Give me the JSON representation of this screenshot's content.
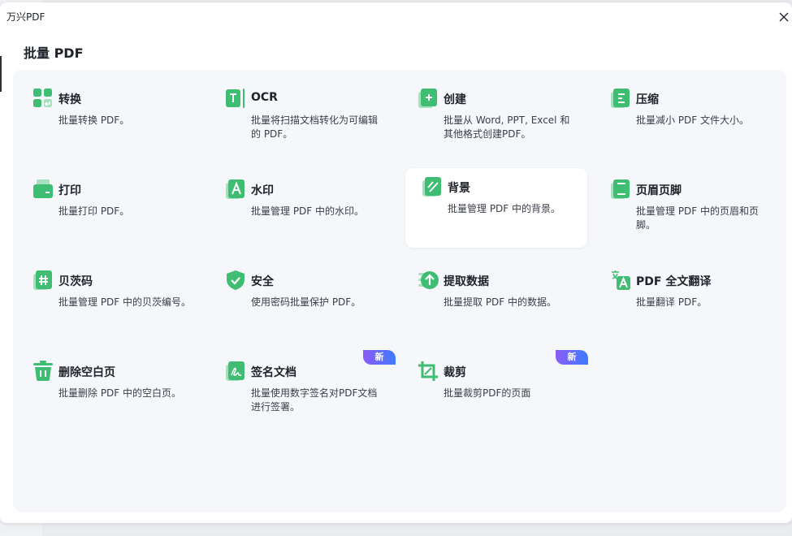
{
  "app": {
    "title": "万兴PDF"
  },
  "page": {
    "heading": "批量 PDF"
  },
  "colors": {
    "accent": "#3ebd73",
    "badge_start": "#8a5cf6",
    "badge_end": "#3e7bff"
  },
  "tools": [
    {
      "name": "转换",
      "desc": "批量转换 PDF。",
      "icon": "convert-icon"
    },
    {
      "name": "OCR",
      "desc": "批量将扫描文档转化为可编辑的 PDF。",
      "icon": "ocr-icon"
    },
    {
      "name": "创建",
      "desc": "批量从 Word, PPT, Excel 和其他格式创建PDF。",
      "icon": "create-icon"
    },
    {
      "name": "压缩",
      "desc": "批量减小 PDF 文件大小。",
      "icon": "compress-icon"
    },
    {
      "name": "打印",
      "desc": "批量打印 PDF。",
      "icon": "print-icon"
    },
    {
      "name": "水印",
      "desc": "批量管理 PDF 中的水印。",
      "icon": "watermark-icon"
    },
    {
      "name": "背景",
      "desc": "批量管理 PDF 中的背景。",
      "icon": "background-icon"
    },
    {
      "name": "页眉页脚",
      "desc": "批量管理 PDF 中的页眉和页脚。",
      "icon": "header-footer-icon"
    },
    {
      "name": "贝茨码",
      "desc": "批量管理 PDF 中的贝茨编号。",
      "icon": "bates-icon"
    },
    {
      "name": "安全",
      "desc": "使用密码批量保护 PDF。",
      "icon": "shield-icon"
    },
    {
      "name": "提取数据",
      "desc": "批量提取 PDF 中的数据。",
      "icon": "extract-icon"
    },
    {
      "name": "PDF 全文翻译",
      "desc": "批量翻译 PDF。",
      "icon": "translate-icon"
    },
    {
      "name": "删除空白页",
      "desc": "批量删除 PDF 中的空白页。",
      "icon": "trash-icon"
    },
    {
      "name": "签名文档",
      "desc": "批量使用数字签名对PDF文档进行签署。",
      "icon": "sign-icon",
      "badge": "新"
    },
    {
      "name": "裁剪",
      "desc": "批量裁剪PDF的页面",
      "icon": "crop-icon",
      "badge": "新"
    }
  ]
}
